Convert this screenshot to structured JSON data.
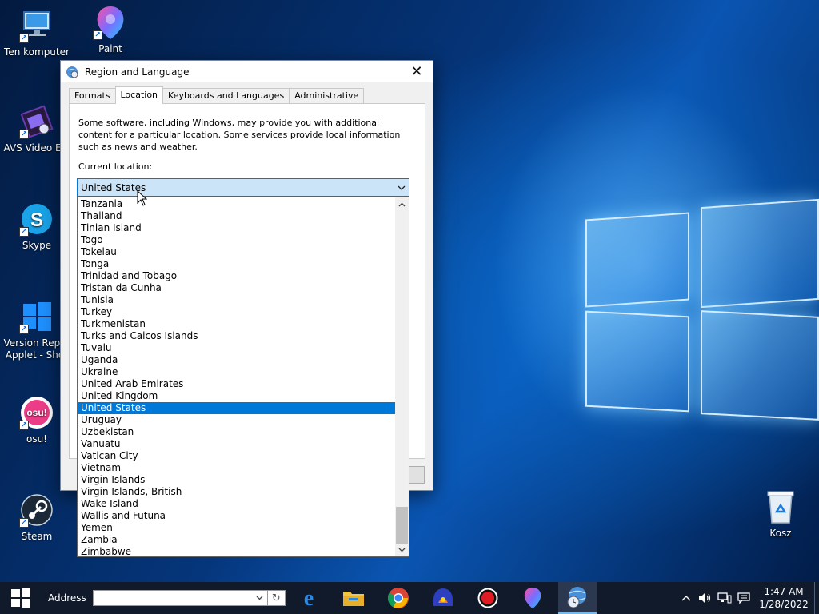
{
  "desktop": {
    "icons": [
      {
        "label": "Ten komputer",
        "icon": "computer-icon"
      },
      {
        "label": "Paint",
        "icon": "paint-icon"
      },
      {
        "label": "AVS Video Edi",
        "icon": "film-icon"
      },
      {
        "label": "Skype",
        "icon": "skype-icon"
      },
      {
        "label": "Version Repor",
        "label2": "Applet - Shor",
        "icon": "windows-icon"
      },
      {
        "label": "osu!",
        "icon": "osu-icon",
        "glyph_text": "osu!"
      },
      {
        "label": "Steam",
        "icon": "steam-icon"
      },
      {
        "label": "Kosz",
        "icon": "recycle-bin-icon"
      }
    ]
  },
  "dialog": {
    "title": "Region and Language",
    "tabs": [
      "Formats",
      "Location",
      "Keyboards and Languages",
      "Administrative"
    ],
    "active_tab": "Location",
    "intro_text": "Some software, including Windows, may provide you with additional content for a particular location. Some services provide local information such as news and weather.",
    "current_location_label": "Current location:",
    "combo_value": "United States",
    "selected_item": "United States",
    "list_items": [
      "Tanzania",
      "Thailand",
      "Tinian Island",
      "Togo",
      "Tokelau",
      "Tonga",
      "Trinidad and Tobago",
      "Tristan da Cunha",
      "Tunisia",
      "Turkey",
      "Turkmenistan",
      "Turks and Caicos Islands",
      "Tuvalu",
      "Uganda",
      "Ukraine",
      "United Arab Emirates",
      "United Kingdom",
      "United States",
      "Uruguay",
      "Uzbekistan",
      "Vanuatu",
      "Vatican City",
      "Vietnam",
      "Virgin Islands",
      "Virgin Islands, British",
      "Wake Island",
      "Wallis and Futuna",
      "Yemen",
      "Zambia",
      "Zimbabwe"
    ]
  },
  "taskbar": {
    "address_label": "Address",
    "address_value": "",
    "apps": [
      {
        "name": "edge-icon"
      },
      {
        "name": "file-explorer-icon"
      },
      {
        "name": "chrome-icon"
      },
      {
        "name": "app-icon"
      },
      {
        "name": "record-icon"
      },
      {
        "name": "paint-icon"
      },
      {
        "name": "region-language-icon",
        "active": true
      }
    ],
    "clock_time": "1:47 AM",
    "clock_date": "1/28/2022"
  },
  "colors": {
    "accent": "#0078d7",
    "taskbar": "#101a2b",
    "selection": "#0078d7",
    "combo_bg": "#cce4f7"
  }
}
